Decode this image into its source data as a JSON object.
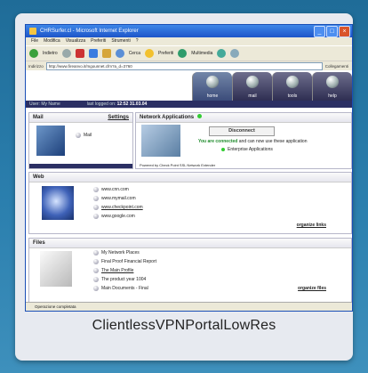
{
  "caption": "ClientlessVPNPortalLowRes",
  "browser": {
    "title": "CHRSurfer.cl - Microsoft Internet Explorer",
    "menu": [
      "File",
      "Modifica",
      "Visualizza",
      "Preferiti",
      "Strumenti",
      "?"
    ],
    "toolbar": [
      "Indietro",
      "Cerca",
      "Preferiti",
      "Multimedia"
    ],
    "address_label": "Indirizzo",
    "address": "http://www.fireanvo.it/mgounnet.cfm?a_d=3760",
    "links_label": "Collegamenti",
    "status": "Operazione completata"
  },
  "portal": {
    "tabs": [
      "home",
      "mail",
      "tools",
      "help"
    ],
    "user_label": "User: My Name",
    "last_logged": "last logged on:",
    "last_time": "12:52 31.03.04"
  },
  "mail": {
    "title": "Mail",
    "settings": "Settings",
    "link": "Mail"
  },
  "netapps": {
    "title": "Network Applications",
    "button": "Disconnect",
    "connected": "You are connected",
    "connected_rest": "and can now use these application",
    "enterprise": "Enterprise Applications",
    "powered": "Powered by Check Point SSL Network Extender"
  },
  "web": {
    "title": "Web",
    "links": [
      "www.cnn.com",
      "www.mymail.com",
      "www.checkpoint.com",
      "www.google.com"
    ],
    "organize": "organize links"
  },
  "files": {
    "title": "Files",
    "links": [
      "My Network Places",
      "Final Proof Financial Report",
      "The Main Profile",
      "The product year 1004",
      "Main Documents - Final"
    ],
    "organize": "organize files"
  }
}
